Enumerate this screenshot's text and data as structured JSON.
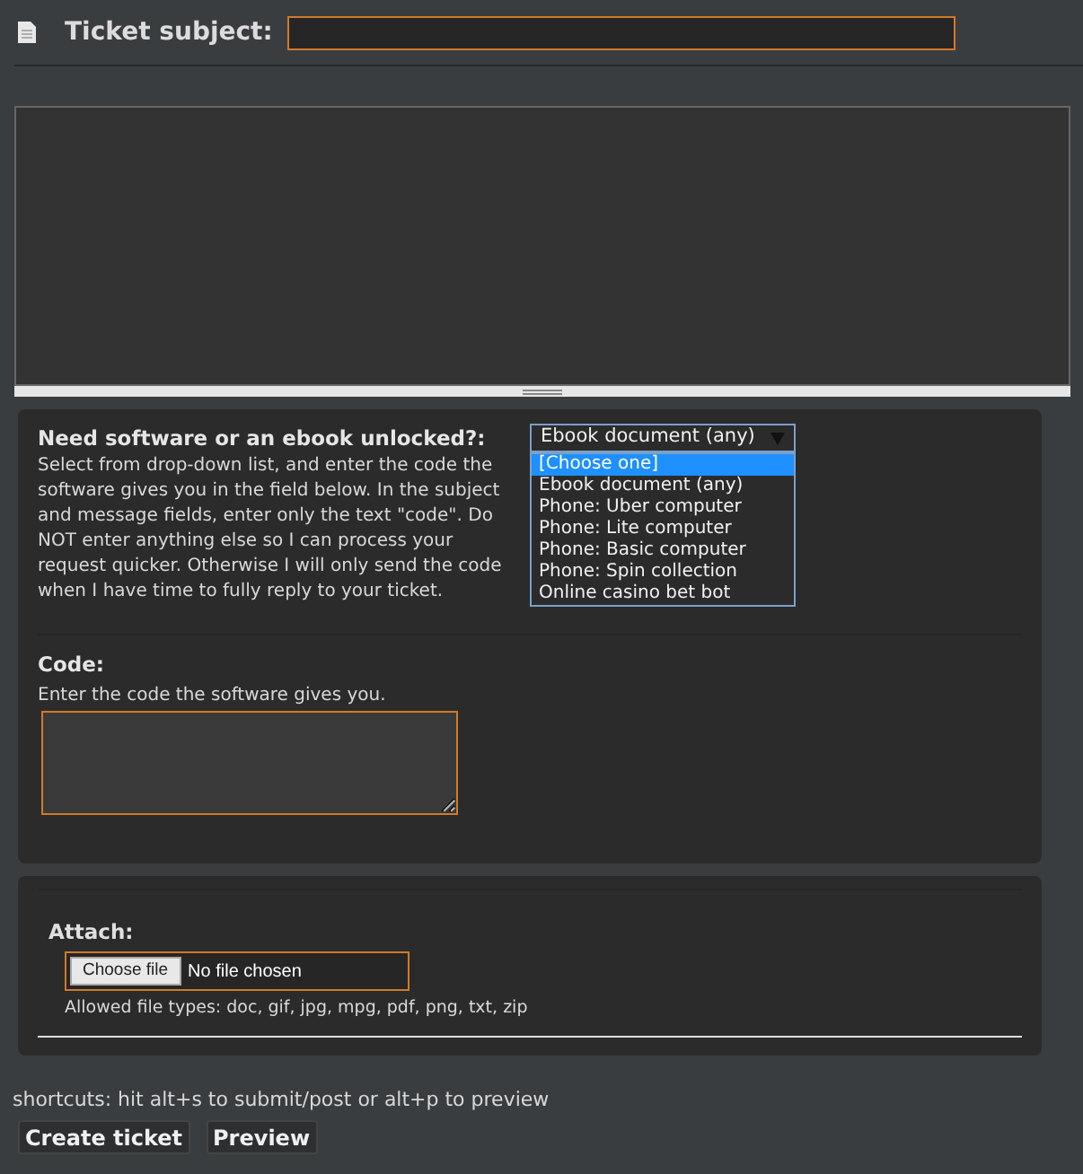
{
  "subject": {
    "label": "Ticket subject:"
  },
  "unlock": {
    "title": "Need software or an ebook unlocked?:",
    "description": "Select from drop-down list, and enter the code the software gives you in the field below. In the subject and message fields, enter only the text \"code\". Do NOT enter anything else so I can process your request quicker. Otherwise I will only send the code when I have time to fully reply to your ticket.",
    "select_value": "Ebook document (any)",
    "expanded": true,
    "options": [
      {
        "label": "[Choose one]",
        "selected": true
      },
      {
        "label": "Ebook document (any)",
        "selected": false
      },
      {
        "label": "Phone: Uber computer",
        "selected": false
      },
      {
        "label": "Phone: Lite computer",
        "selected": false
      },
      {
        "label": "Phone: Basic computer",
        "selected": false
      },
      {
        "label": "Phone: Spin collection",
        "selected": false
      },
      {
        "label": "Online casino bet bot",
        "selected": false
      }
    ]
  },
  "code": {
    "label": "Code:",
    "hint": "Enter the code the software gives you."
  },
  "attach": {
    "label": "Attach:",
    "button": "Choose file",
    "status": "No file chosen",
    "allowed": "Allowed file types: doc, gif, jpg, mpg, pdf, png, txt, zip"
  },
  "shortcuts": "shortcuts: hit alt+s to submit/post or alt+p to preview",
  "buttons": [
    "Create ticket",
    "Preview"
  ]
}
